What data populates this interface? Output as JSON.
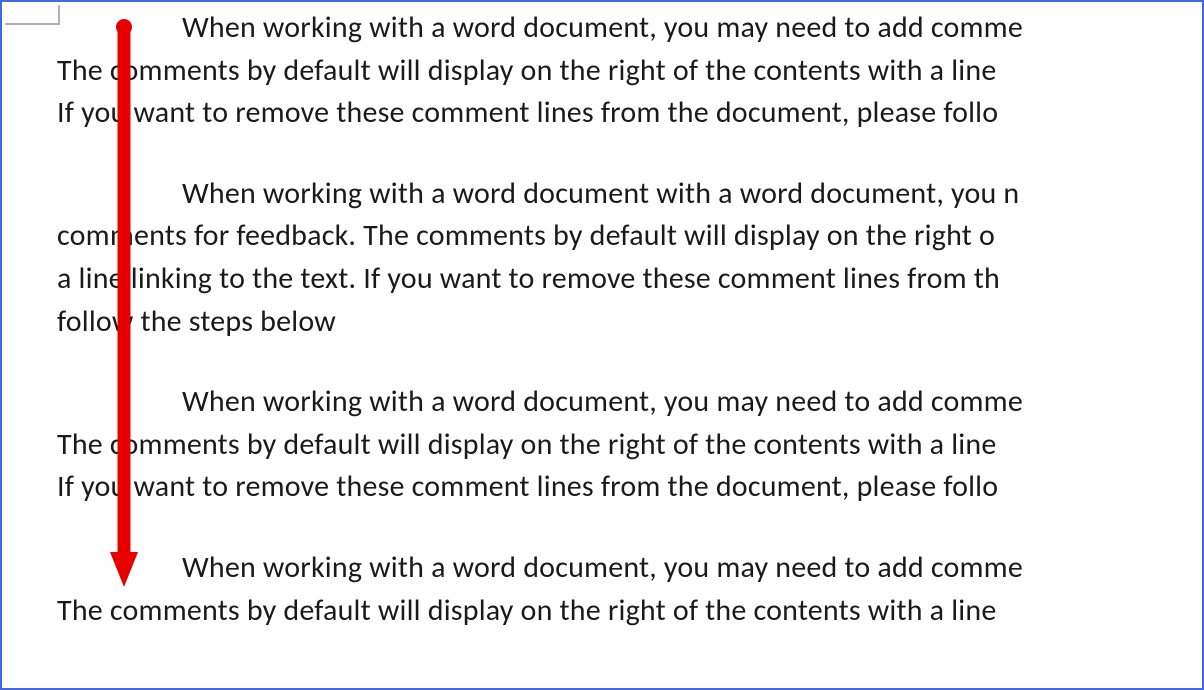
{
  "document": {
    "paragraphs": [
      {
        "line1": "When working with a word document, you may need to add comme",
        "line2": "The comments by default will display on the right of the contents with a line",
        "line3": "If you want to remove these comment lines from the document, please follo"
      },
      {
        "line1": "When working with a word document with a word document, you n",
        "line2": "comments for feedback. The comments by default will display on the right o",
        "line3": "a line linking to the text. If you want to remove these comment lines from th",
        "line4": "follow the steps below"
      },
      {
        "line1": "When working with a word document, you may need to add comme",
        "line2": "The comments by default will display on the right of the contents with a line",
        "line3": "If you want to remove these comment lines from the document, please follo"
      },
      {
        "line1": "When working with a word document, you may need to add comme",
        "line2": "The comments by default will display on the right of the contents with a line"
      }
    ]
  },
  "annotation": {
    "arrow_color": "#E60000"
  }
}
